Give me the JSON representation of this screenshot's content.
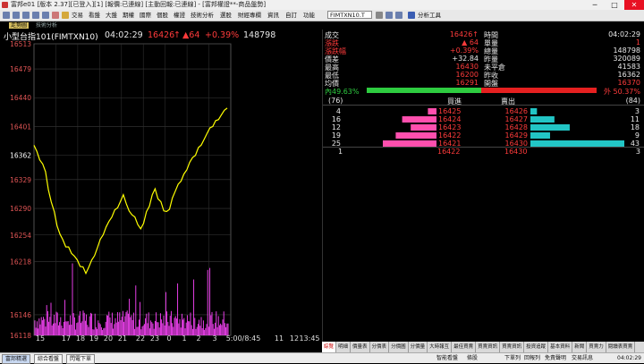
{
  "window": {
    "title": "富邦e01 [版本 2.37][已登入][1] [報價:已連線] [主動回報:已連線] - [富邦權證**-商品盤勢]",
    "buttons": [
      "─",
      "□",
      "✕"
    ]
  },
  "menu": {
    "items": [
      "交易",
      "看盤",
      "大盤",
      "期權",
      "國際",
      "個股",
      "權證",
      "技術分析",
      "選股",
      "財經專欄",
      "資訊",
      "自訂",
      "功能"
    ],
    "code_label": "代碼",
    "code_value": "FIMTXN10.T",
    "analysis_label": "分析工具"
  },
  "subtabs": {
    "active": "走勢圖",
    "other": "技術分析"
  },
  "chart_header": {
    "name": "小型台指101(FIMTXN10)",
    "time": "04:02:29",
    "price": "16426",
    "arrow": "↑",
    "change": "▲64",
    "pct": "+0.39%",
    "volume": "148798"
  },
  "quote": {
    "left": [
      {
        "label": "成交",
        "value": "16426↑"
      },
      {
        "label": "漲跌",
        "value": "▲ 64"
      },
      {
        "label": "漲跌幅",
        "value": "+0.39%"
      },
      {
        "label": "價差",
        "value": "+32.84"
      },
      {
        "label": "最高",
        "value": "16430"
      },
      {
        "label": "最低",
        "value": "16200"
      },
      {
        "label": "均價",
        "value": "16291"
      }
    ],
    "right": [
      {
        "label": "時間",
        "value": "04:02:29"
      },
      {
        "label": "單量",
        "value": "1"
      },
      {
        "label": "總量",
        "value": "148798"
      },
      {
        "label": "昨量",
        "value": "320089"
      },
      {
        "label": "未平倉",
        "value": "41583"
      },
      {
        "label": "昨收",
        "value": "16362"
      },
      {
        "label": "開盤",
        "value": "16370"
      }
    ],
    "inner_label": "內49.63%",
    "outer_label": "外 50.37%",
    "inner_pct": 49.63,
    "outer_pct": 50.37
  },
  "depth": {
    "bid_total": "(76)",
    "ask_total": "(84)",
    "bid_header": "買進",
    "ask_header": "賣出",
    "rows": [
      {
        "bid_qty": "4",
        "bid_price": "16425",
        "ask_price": "16426",
        "ask_qty": "3"
      },
      {
        "bid_qty": "16",
        "bid_price": "16424",
        "ask_price": "16427",
        "ask_qty": "11"
      },
      {
        "bid_qty": "12",
        "bid_price": "16423",
        "ask_price": "16428",
        "ask_qty": "18"
      },
      {
        "bid_qty": "19",
        "bid_price": "16422",
        "ask_price": "16429",
        "ask_qty": "9"
      },
      {
        "bid_qty": "25",
        "bid_price": "16421",
        "ask_price": "16430",
        "ask_qty": "43"
      }
    ],
    "bid_bar_values": [
      4,
      16,
      12,
      19,
      25
    ],
    "ask_bar_values": [
      3,
      11,
      18,
      9,
      43
    ],
    "last": {
      "left_qty": "1",
      "bid_price": "16422",
      "ask_price": "16430",
      "right_qty": "3"
    }
  },
  "chart_data": {
    "type": "line",
    "title": "小型台指101(FIMTXN10)",
    "ylim": [
      16118,
      16513
    ],
    "ytick_labels": [
      "16513",
      "16479",
      "16440",
      "16401",
      "16362",
      "16329",
      "16290",
      "16254",
      "16218",
      "16146",
      "16118"
    ],
    "xtick_labels": [
      "15",
      "17",
      "18",
      "19",
      "20",
      "21",
      "22",
      "23",
      "0",
      "1",
      "2",
      "3",
      "5:00/8:45",
      "11",
      "12",
      "13:45"
    ],
    "reference": 16362,
    "series": [
      {
        "values": [
          16375,
          16366,
          16358,
          16350,
          16340,
          16318,
          16300,
          16285,
          16268,
          16255,
          16246,
          16240,
          16236,
          16230,
          16225,
          16220,
          16214,
          16208,
          16202,
          16210,
          16218,
          16228,
          16238,
          16246,
          16256,
          16262,
          16272,
          16280,
          16285,
          16290,
          16298,
          16305,
          16296,
          16288,
          16280,
          16275,
          16268,
          16262,
          16270,
          16282,
          16295,
          16308,
          16318,
          16305,
          16296,
          16290,
          16288,
          16292,
          16302,
          16312,
          16322,
          16330,
          16338,
          16345,
          16352,
          16358,
          16364,
          16370,
          16378,
          16384,
          16392,
          16398,
          16402,
          16406,
          16410,
          16416,
          16420,
          16426
        ]
      }
    ]
  },
  "bottom_tabs": [
    "綜覽",
    "明細",
    "價量表",
    "分價表",
    "分價圖",
    "分價量",
    "大時報互",
    "最佳買賣",
    "買賣資訊",
    "買賣資訊",
    "投資追蹤",
    "基本資料",
    "新聞",
    "買賣力",
    "閱讀表買賣"
  ],
  "status": {
    "left_buttons": [
      "富邦精選",
      "綜合看盤",
      "閃電下單"
    ],
    "right_items": [
      "智能看盤",
      "條股",
      "下單列",
      "回報列",
      "免責聲明"
    ],
    "time": "04:02:29",
    "trade": "交易訊息"
  },
  "colors": {
    "price_line": "#ffff00",
    "volume": "#ff44ff",
    "bid_bar": "#ff4fae",
    "ask_bar": "#22c5c5",
    "up": "#ff3b3b"
  }
}
